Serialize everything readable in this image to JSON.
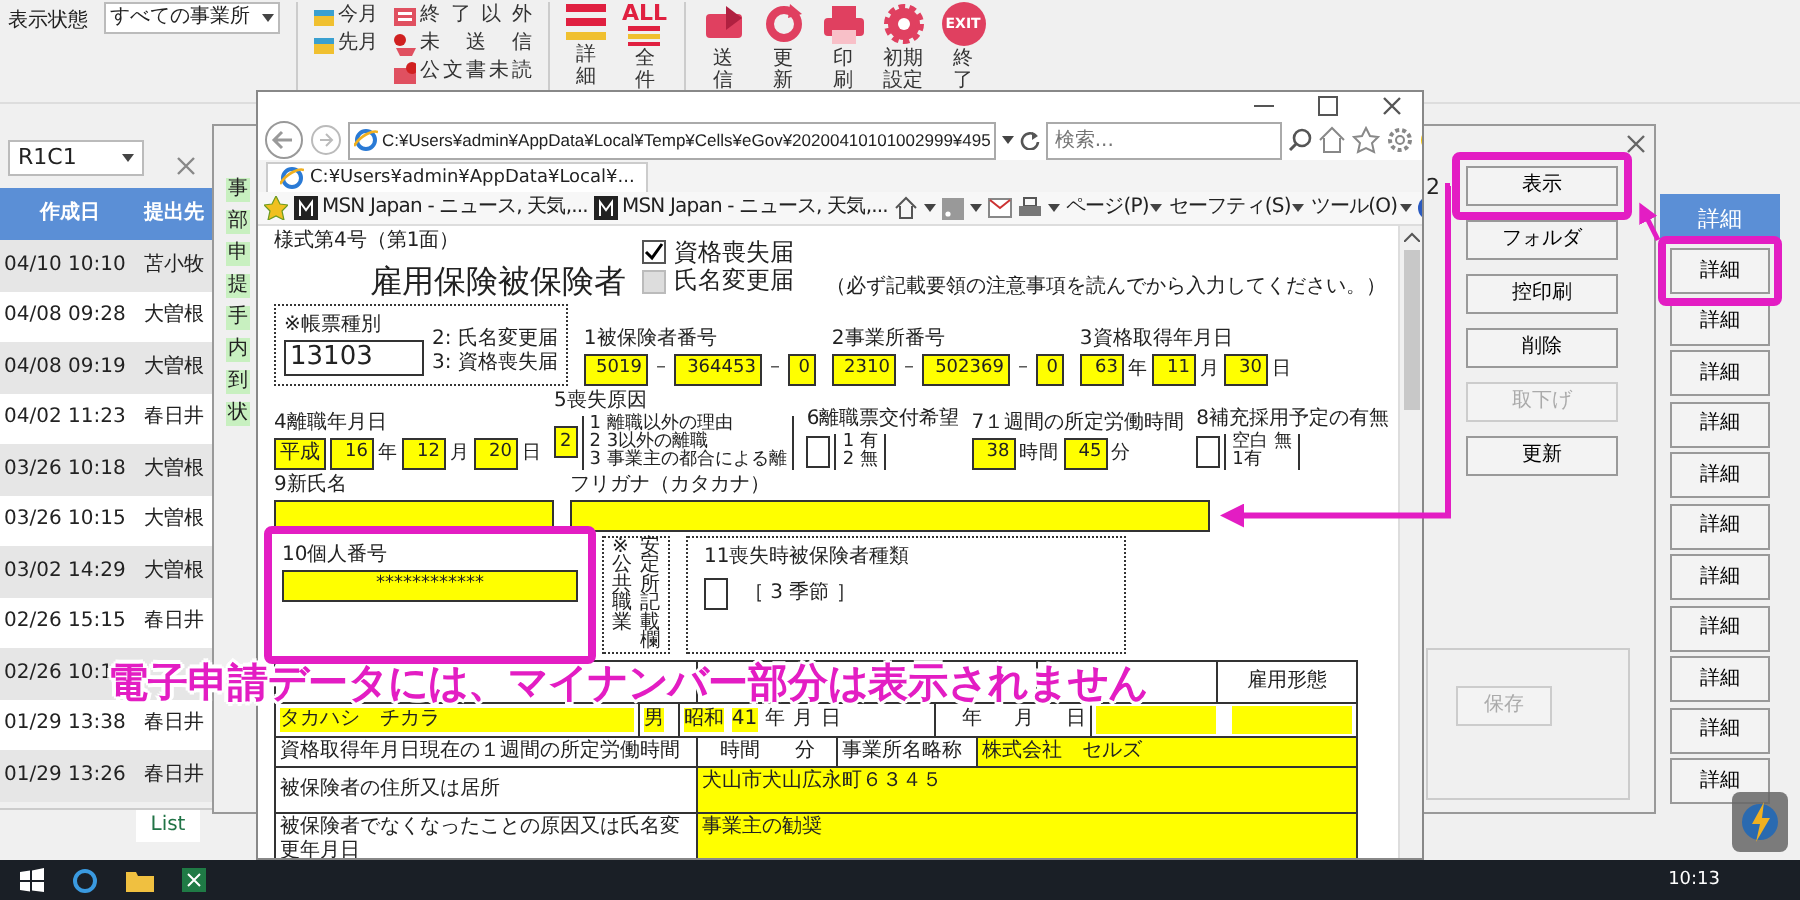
{
  "toolbar": {
    "filter_label": "表示状態",
    "filter_value": "すべての事業所",
    "period_filters": [
      "今月",
      "先月"
    ],
    "status_filters": [
      {
        "label": "終了以外",
        "kind": "list"
      },
      {
        "label": "未送信",
        "kind": "unsent"
      },
      {
        "label": "公文書未読",
        "kind": "unread"
      }
    ],
    "view_buttons": [
      {
        "label": "詳細",
        "kind": "detail"
      },
      {
        "label": "全件",
        "kind": "all",
        "icon_text": "ALL"
      }
    ],
    "action_buttons": [
      {
        "label": "送信",
        "kind": "send"
      },
      {
        "label": "更新",
        "kind": "refresh"
      },
      {
        "label": "印刷",
        "kind": "print"
      },
      {
        "label": "初期設定",
        "kind": "settings"
      },
      {
        "label": "終了",
        "kind": "exit",
        "icon_text": "EXIT"
      }
    ]
  },
  "name_box": "R1C1",
  "list": {
    "columns": [
      "作成日",
      "提出先"
    ],
    "rows": [
      {
        "date": "04/10 10:10",
        "destination": "苫小牧"
      },
      {
        "date": "04/08 09:28",
        "destination": "大曽根"
      },
      {
        "date": "04/08 09:19",
        "destination": "大曽根"
      },
      {
        "date": "04/02 11:23",
        "destination": "春日井"
      },
      {
        "date": "03/26 10:18",
        "destination": "大曽根"
      },
      {
        "date": "03/26 10:15",
        "destination": "大曽根"
      },
      {
        "date": "03/02 14:29",
        "destination": "大曽根"
      },
      {
        "date": "02/26 15:15",
        "destination": "春日井"
      },
      {
        "date": "02/26 10:1"
      },
      {
        "date": "01/29 13:38",
        "destination": "春日井"
      },
      {
        "date": "01/29 13:26",
        "destination": "春日井"
      }
    ],
    "sheet_tab": "List"
  },
  "detail_column": {
    "header": "詳細",
    "buttons": [
      "詳細",
      "詳細",
      "詳細",
      "詳細",
      "詳細",
      "詳細",
      "詳細",
      "詳細",
      "詳細",
      "詳細",
      "詳細"
    ]
  },
  "dialog": {
    "side_labels": [
      "事",
      "部",
      "申",
      "提",
      "手",
      "内",
      "到",
      "状"
    ],
    "value": "2",
    "buttons": [
      {
        "label": "表示",
        "disabled": false
      },
      {
        "label": "フォルダ",
        "disabled": false
      },
      {
        "label": "控印刷",
        "disabled": false
      },
      {
        "label": "削除",
        "disabled": false
      },
      {
        "label": "取下げ",
        "disabled": true
      },
      {
        "label": "更新",
        "disabled": false
      }
    ],
    "save_button": {
      "label": "保存",
      "disabled": true
    }
  },
  "browser": {
    "address": "C:¥Users¥admin¥AppData¥Local¥Temp¥Cells¥eGov¥20200410101002999¥495",
    "search_placeholder": "検索...",
    "tabs": [
      {
        "label": "C:¥Users¥admin¥AppData¥Local¥...",
        "selected": true
      }
    ],
    "favorites": [
      "MSN Japan - ニュース, 天気,...",
      "MSN Japan - ニュース, 天気,..."
    ],
    "menus": [
      "ページ(P)",
      "セーフティ(S)",
      "ツール(O)"
    ]
  },
  "form": {
    "form_number": "様式第4号（第1面）",
    "title": "雇用保険被保険者",
    "notice_types": [
      {
        "label": "資格喪失届",
        "checked": true
      },
      {
        "label": "氏名変更届",
        "checked": false
      }
    ],
    "note": "（必ず記載要領の注意事項を読んでから入力してください。）",
    "slip_type": {
      "label": "※帳票種別",
      "value": "13103",
      "options": [
        "2: 氏名変更届",
        "3: 資格喪失届"
      ]
    },
    "row_1": [
      {
        "label": "1被保険者番号",
        "kind": "code",
        "parts": [
          "5019",
          "364453",
          "0"
        ],
        "separator": "－"
      },
      {
        "label": "2事業所番号",
        "kind": "code",
        "parts": [
          "2310",
          "502369",
          "0"
        ],
        "separator": "－"
      },
      {
        "label": "3資格取得年月日",
        "kind": "date",
        "parts": [
          {
            "value": "63",
            "unit": "年"
          },
          {
            "value": "11",
            "unit": "月"
          },
          {
            "value": "30",
            "unit": "日"
          }
        ]
      }
    ],
    "row_2": [
      {
        "label": "4離職年月日",
        "kind": "date",
        "era": "平成",
        "parts": [
          {
            "value": "16",
            "unit": "年"
          },
          {
            "value": "12",
            "unit": "月"
          },
          {
            "value": "20",
            "unit": "日"
          }
        ]
      },
      {
        "label": "5喪失原因",
        "kind": "choice",
        "value": "2",
        "options": [
          "1 離職以外の理由",
          "2 3以外の離職",
          "3 事業主の都合による離"
        ]
      },
      {
        "label": "6離職票交付希望",
        "kind": "choice",
        "options": [
          "1 有",
          "2 無"
        ]
      },
      {
        "label": "7１週間の所定労働時間",
        "kind": "date",
        "parts": [
          {
            "value": "38",
            "unit": "時間"
          },
          {
            "value": "45",
            "unit": "分"
          }
        ]
      },
      {
        "label": "8補充採用予定の有無",
        "kind": "choice",
        "options": [
          "空白 無",
          "1有"
        ]
      }
    ],
    "row_3": [
      "9新氏名",
      "フリガナ（カタカナ）"
    ],
    "personal_number": {
      "label": "10個人番号",
      "value": "************"
    },
    "office_use": [
      "※公共職業",
      "安定所記載欄"
    ],
    "insured_type": {
      "label": "11喪失時被保険者種類",
      "note": "［ 3 季節 ］"
    },
    "person_table": {
      "header": "雇用形態",
      "name_row": {
        "name": "タカハシ　チカラ",
        "sex": "男",
        "era": "昭和",
        "year": "41",
        "units": [
          "年",
          "月",
          "日"
        ],
        "date_units": [
          "年",
          "月",
          "日"
        ]
      },
      "hours_row": {
        "label": "資格取得年月日現在の１週間の所定労働時間",
        "units": [
          "時間",
          "分"
        ],
        "office_label": "事業所名略称",
        "office_value": "株式会社　セルズ"
      },
      "address_row": {
        "label": "被保険者の住所又は居所",
        "value": "犬山市犬山広永町６３４５"
      },
      "reason_row": {
        "label": "被保険者でなくなったことの原因又は氏名変更年月日",
        "value": "事業主の勧奨"
      }
    }
  },
  "caption": "電子申請データには、マイナンバー部分は表示されません",
  "taskbar": {
    "time": "10:13"
  }
}
